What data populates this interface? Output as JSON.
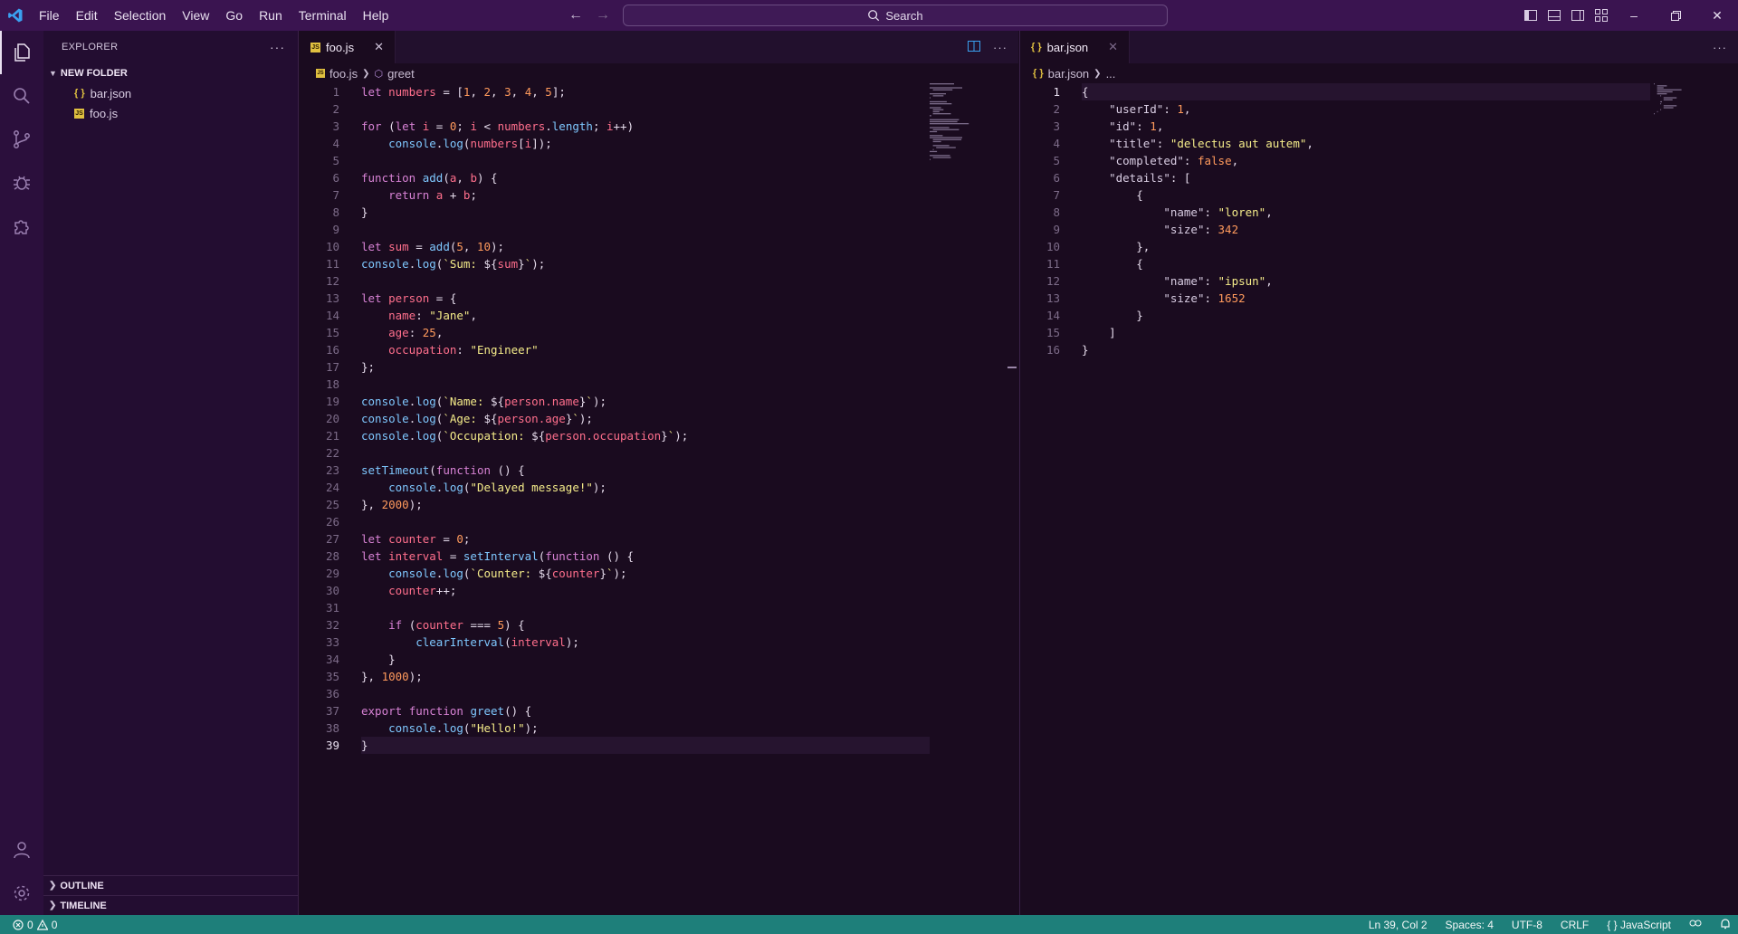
{
  "menu": [
    "File",
    "Edit",
    "Selection",
    "View",
    "Go",
    "Run",
    "Terminal",
    "Help"
  ],
  "search": {
    "label": "Search"
  },
  "explorer": {
    "title": "EXPLORER",
    "folder": "NEW FOLDER",
    "files": [
      {
        "name": "bar.json",
        "icon": "json-file-icon"
      },
      {
        "name": "foo.js",
        "icon": "js-file-icon"
      }
    ],
    "outline": "OUTLINE",
    "timeline": "TIMELINE"
  },
  "editor1": {
    "tab": "foo.js",
    "breadcrumb_file": "foo.js",
    "breadcrumb_symbol": "greet",
    "active_line": 39,
    "lines": [
      "let numbers = [1, 2, 3, 4, 5];",
      "",
      "for (let i = 0; i < numbers.length; i++)",
      "    console.log(numbers[i]);",
      "",
      "function add(a, b) {",
      "    return a + b;",
      "}",
      "",
      "let sum = add(5, 10);",
      "console.log(`Sum: ${sum}`);",
      "",
      "let person = {",
      "    name: \"Jane\",",
      "    age: 25,",
      "    occupation: \"Engineer\"",
      "};",
      "",
      "console.log(`Name: ${person.name}`);",
      "console.log(`Age: ${person.age}`);",
      "console.log(`Occupation: ${person.occupation}`);",
      "",
      "setTimeout(function () {",
      "    console.log(\"Delayed message!\");",
      "}, 2000);",
      "",
      "let counter = 0;",
      "let interval = setInterval(function () {",
      "    console.log(`Counter: ${counter}`);",
      "    counter++;",
      "",
      "    if (counter === 5) {",
      "        clearInterval(interval);",
      "    }",
      "}, 1000);",
      "",
      "export function greet() {",
      "    console.log(\"Hello!\");",
      "}"
    ]
  },
  "editor2": {
    "tab": "bar.json",
    "breadcrumb_file": "bar.json",
    "breadcrumb_more": "...",
    "active_line": 1,
    "lines": [
      "{",
      "    \"userId\": 1,",
      "    \"id\": 1,",
      "    \"title\": \"delectus aut autem\",",
      "    \"completed\": false,",
      "    \"details\": [",
      "        {",
      "            \"name\": \"loren\",",
      "            \"size\": 342",
      "        },",
      "        {",
      "            \"name\": \"ipsun\",",
      "            \"size\": 1652",
      "        }",
      "    ]",
      "}"
    ]
  },
  "status": {
    "errors": "0",
    "warnings": "0",
    "position": "Ln 39, Col 2",
    "spaces": "Spaces: 4",
    "encoding": "UTF-8",
    "eol": "CRLF",
    "language": "JavaScript"
  },
  "colors": {
    "accent": "#1e7f7a",
    "titlebar": "#3a1450",
    "activitybar": "#2b0f3c"
  }
}
